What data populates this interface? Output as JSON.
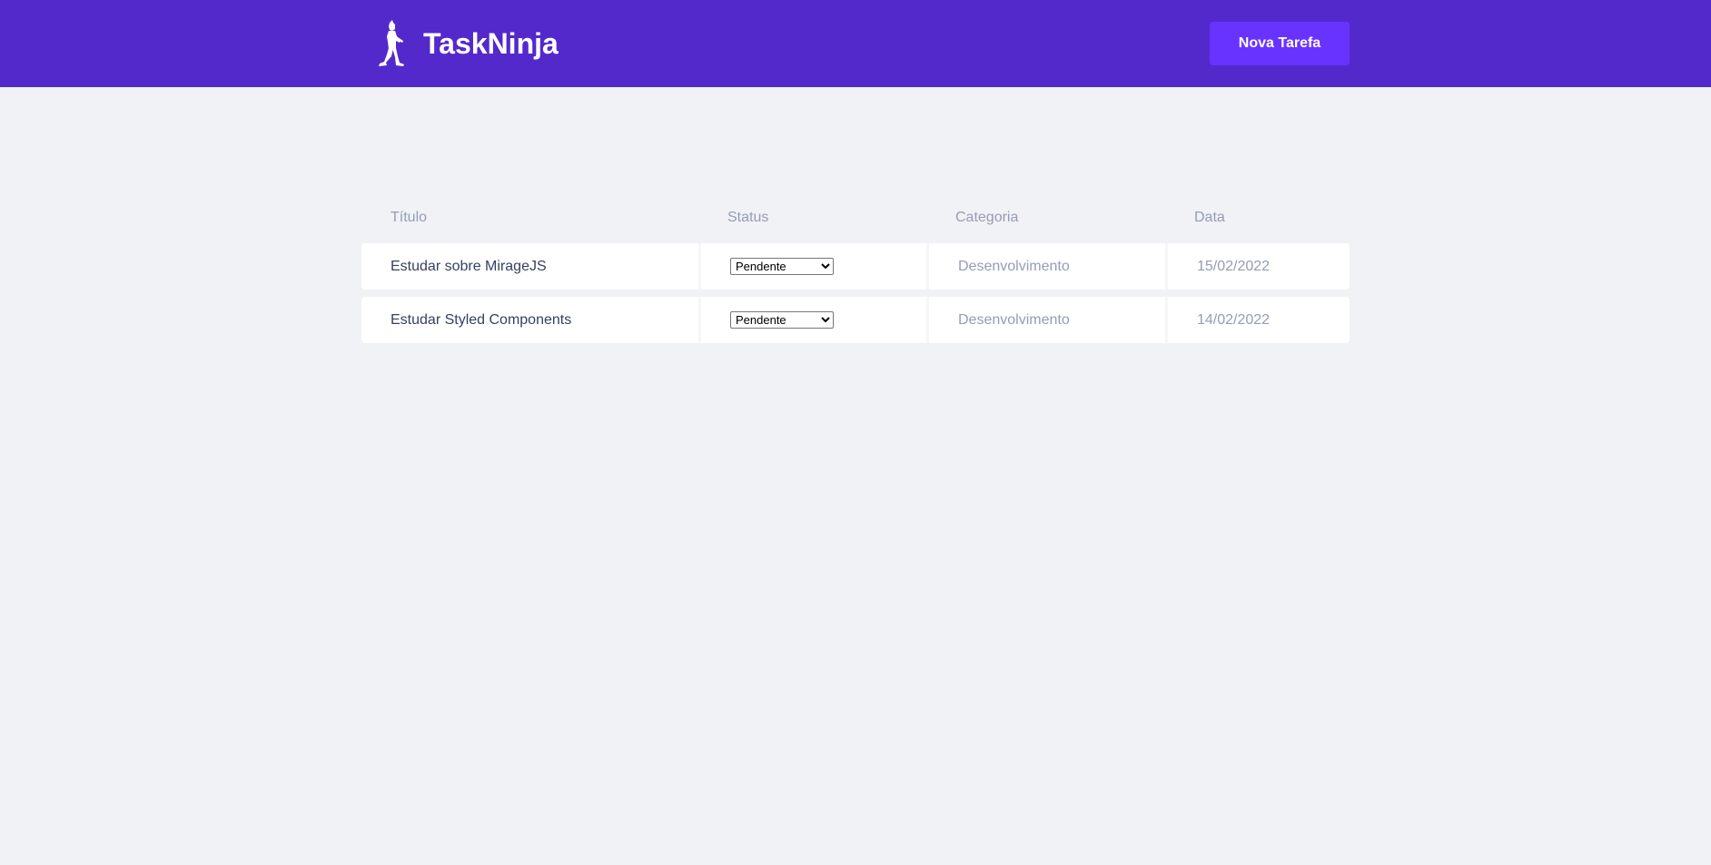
{
  "header": {
    "app_title": "TaskNinja",
    "new_task_label": "Nova Tarefa",
    "logo_icon": "ninja-icon"
  },
  "table": {
    "columns": [
      "Título",
      "Status",
      "Categoria",
      "Data"
    ],
    "rows": [
      {
        "title": "Estudar sobre MirageJS",
        "status": "Pendente",
        "category": "Desenvolvimento",
        "date": "15/02/2022"
      },
      {
        "title": "Estudar Styled Components",
        "status": "Pendente",
        "category": "Desenvolvimento",
        "date": "14/02/2022"
      }
    ]
  },
  "colors": {
    "header_bg": "#5429cc",
    "button_bg": "#6933ff",
    "page_bg": "#f0f2f5",
    "title_text": "#363f5f",
    "muted_text": "#969cb3"
  }
}
